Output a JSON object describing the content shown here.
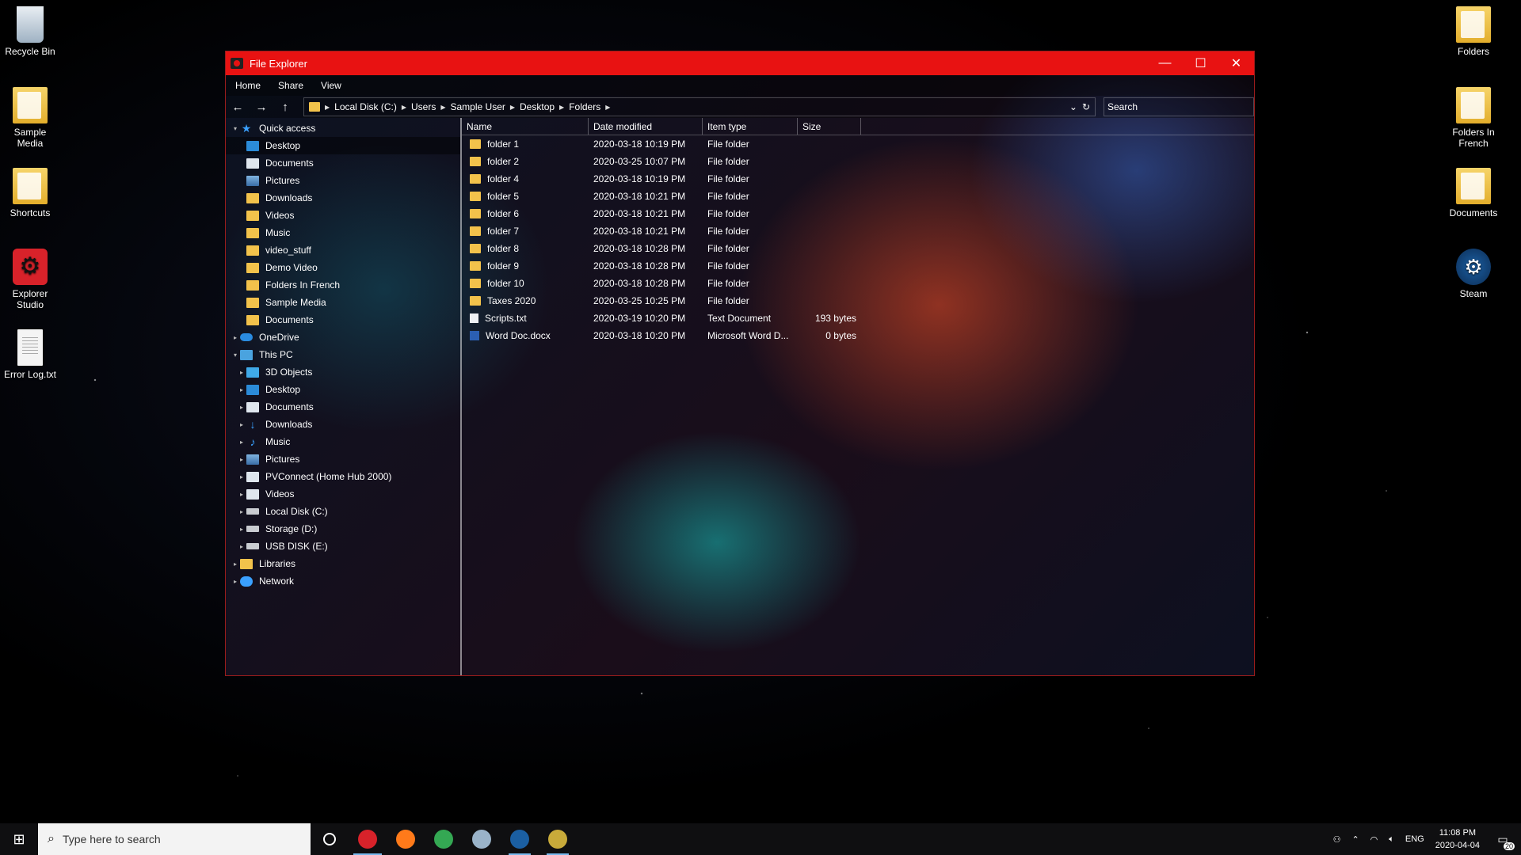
{
  "desktop": {
    "left_icons": [
      {
        "label": "Recycle Bin",
        "icon": "recycle-bin-icon"
      },
      {
        "label": "Sample Media",
        "icon": "folder-icon"
      },
      {
        "label": "Shortcuts",
        "icon": "folder-icon"
      },
      {
        "label": "Explorer Studio",
        "icon": "explorer-studio-icon"
      },
      {
        "label": "Error Log.txt",
        "icon": "text-file-icon"
      }
    ],
    "right_icons": [
      {
        "label": "Folders",
        "icon": "folder-icon"
      },
      {
        "label": "Folders In French",
        "icon": "folder-icon"
      },
      {
        "label": "Documents",
        "icon": "folder-icon"
      },
      {
        "label": "Steam",
        "icon": "steam-icon"
      }
    ]
  },
  "window": {
    "title": "File Explorer",
    "accent_color": "#e81212",
    "controls": {
      "minimize": "—",
      "maximize": "☐",
      "close": "✕"
    },
    "ribbon": [
      "Home",
      "Share",
      "View"
    ],
    "nav": {
      "back": "←",
      "forward": "→",
      "up": "↑"
    },
    "breadcrumb": [
      "Local Disk (C:)",
      "Users",
      "Sample User",
      "Desktop",
      "Folders"
    ],
    "refresh": "↻",
    "search_placeholder": "Search",
    "nav_pane": [
      {
        "label": "Quick access",
        "icon": "star",
        "indent": 0,
        "arrow": "▾"
      },
      {
        "label": "Desktop",
        "icon": "blue",
        "indent": 1,
        "selected": true
      },
      {
        "label": "Documents",
        "icon": "doc",
        "indent": 1
      },
      {
        "label": "Pictures",
        "icon": "pic",
        "indent": 1
      },
      {
        "label": "Downloads",
        "icon": "folder",
        "indent": 1
      },
      {
        "label": "Videos",
        "icon": "folder",
        "indent": 1
      },
      {
        "label": "Music",
        "icon": "folder",
        "indent": 1
      },
      {
        "label": "video_stuff",
        "icon": "folder",
        "indent": 1
      },
      {
        "label": "Demo Video",
        "icon": "folder",
        "indent": 1
      },
      {
        "label": "Folders In French",
        "icon": "folder",
        "indent": 1
      },
      {
        "label": "Sample Media",
        "icon": "folder",
        "indent": 1
      },
      {
        "label": "Documents",
        "icon": "folder",
        "indent": 1
      },
      {
        "label": "OneDrive",
        "icon": "cloud",
        "indent": 0,
        "arrow": "▸"
      },
      {
        "label": "This PC",
        "icon": "pc",
        "indent": 0,
        "arrow": "▾"
      },
      {
        "label": "3D Objects",
        "icon": "cube",
        "indent": 1,
        "arrow": "▸"
      },
      {
        "label": "Desktop",
        "icon": "blue",
        "indent": 1,
        "arrow": "▸"
      },
      {
        "label": "Documents",
        "icon": "doc",
        "indent": 1,
        "arrow": "▸"
      },
      {
        "label": "Downloads",
        "icon": "dl",
        "indent": 1,
        "arrow": "▸"
      },
      {
        "label": "Music",
        "icon": "music",
        "indent": 1,
        "arrow": "▸"
      },
      {
        "label": "Pictures",
        "icon": "pic",
        "indent": 1,
        "arrow": "▸"
      },
      {
        "label": "PVConnect (Home Hub 2000)",
        "icon": "doc",
        "indent": 1,
        "arrow": "▸"
      },
      {
        "label": "Videos",
        "icon": "doc",
        "indent": 1,
        "arrow": "▸"
      },
      {
        "label": "Local Disk (C:)",
        "icon": "drive",
        "indent": 1,
        "arrow": "▸"
      },
      {
        "label": "Storage (D:)",
        "icon": "drive",
        "indent": 1,
        "arrow": "▸"
      },
      {
        "label": "USB DISK (E:)",
        "icon": "drive",
        "indent": 1,
        "arrow": "▸"
      },
      {
        "label": "Libraries",
        "icon": "lib",
        "indent": 0,
        "arrow": "▸"
      },
      {
        "label": "Network",
        "icon": "net",
        "indent": 0,
        "arrow": "▸"
      }
    ],
    "columns": {
      "name": "Name",
      "date": "Date modified",
      "type": "Item type",
      "size": "Size"
    },
    "files": [
      {
        "name": "folder 1",
        "date": "2020-03-18 10:19 PM",
        "type": "File folder",
        "size": "",
        "icon": "folder"
      },
      {
        "name": "folder 2",
        "date": "2020-03-25 10:07 PM",
        "type": "File folder",
        "size": "",
        "icon": "folder"
      },
      {
        "name": "folder 4",
        "date": "2020-03-18 10:19 PM",
        "type": "File folder",
        "size": "",
        "icon": "folder"
      },
      {
        "name": "folder 5",
        "date": "2020-03-18 10:21 PM",
        "type": "File folder",
        "size": "",
        "icon": "folder"
      },
      {
        "name": "folder 6",
        "date": "2020-03-18 10:21 PM",
        "type": "File folder",
        "size": "",
        "icon": "folder"
      },
      {
        "name": "folder 7",
        "date": "2020-03-18 10:21 PM",
        "type": "File folder",
        "size": "",
        "icon": "folder"
      },
      {
        "name": "folder 8",
        "date": "2020-03-18 10:28 PM",
        "type": "File folder",
        "size": "",
        "icon": "folder"
      },
      {
        "name": "folder 9",
        "date": "2020-03-18 10:28 PM",
        "type": "File folder",
        "size": "",
        "icon": "folder"
      },
      {
        "name": "folder 10",
        "date": "2020-03-18 10:28 PM",
        "type": "File folder",
        "size": "",
        "icon": "folder"
      },
      {
        "name": "Taxes 2020",
        "date": "2020-03-25 10:25 PM",
        "type": "File folder",
        "size": "",
        "icon": "folder"
      },
      {
        "name": "Scripts.txt",
        "date": "2020-03-19 10:20 PM",
        "type": "Text Document",
        "size": "193 bytes",
        "icon": "txt"
      },
      {
        "name": "Word Doc.docx",
        "date": "2020-03-18 10:20 PM",
        "type": "Microsoft Word D...",
        "size": "0 bytes",
        "icon": "word"
      }
    ]
  },
  "taskbar": {
    "search_placeholder": "Type here to search",
    "apps": [
      {
        "name": "explorer-studio-taskbar-icon",
        "color": "#d8222a",
        "active": true
      },
      {
        "name": "firefox-icon",
        "color": "#ff7a1a"
      },
      {
        "name": "chrome-icon",
        "color": "#34a853"
      },
      {
        "name": "file-manager-icon",
        "color": "#9ab3c9"
      },
      {
        "name": "steam-taskbar-icon",
        "color": "#1b5fa2",
        "open": true
      },
      {
        "name": "league-icon",
        "color": "#c8aa3a",
        "open": true
      }
    ],
    "language": "ENG",
    "time": "11:08 PM",
    "date": "2020-04-04",
    "notification_count": "20"
  }
}
